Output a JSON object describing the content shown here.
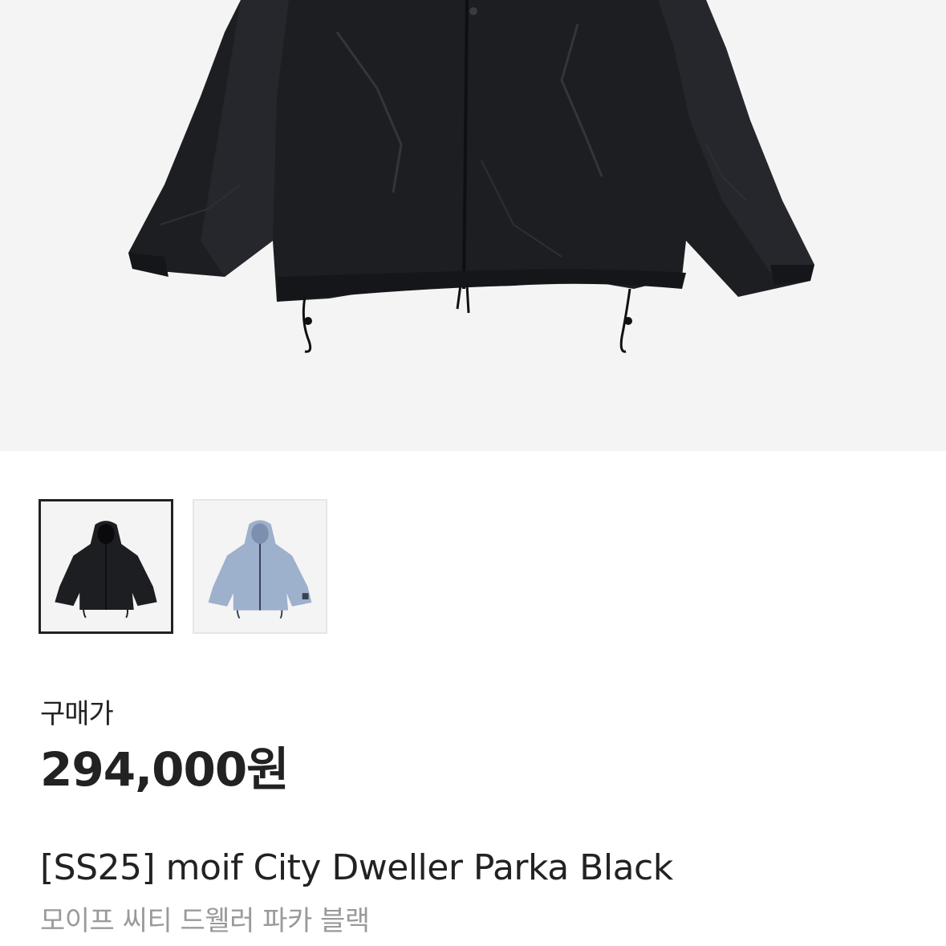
{
  "gallery": {
    "main_image_icon": "black-parka-photo",
    "thumbnails": [
      {
        "icon": "black-parka-thumbnail",
        "color": "#1d1e22",
        "selected": true
      },
      {
        "icon": "blue-parka-thumbnail",
        "color": "#9db0cc",
        "selected": false
      }
    ]
  },
  "product": {
    "price_label": "구매가",
    "price": "294,000원",
    "title_en": "[SS25] moif City Dweller Parka Black",
    "title_ko": "모이프 씨티 드웰러 파카 블랙"
  }
}
